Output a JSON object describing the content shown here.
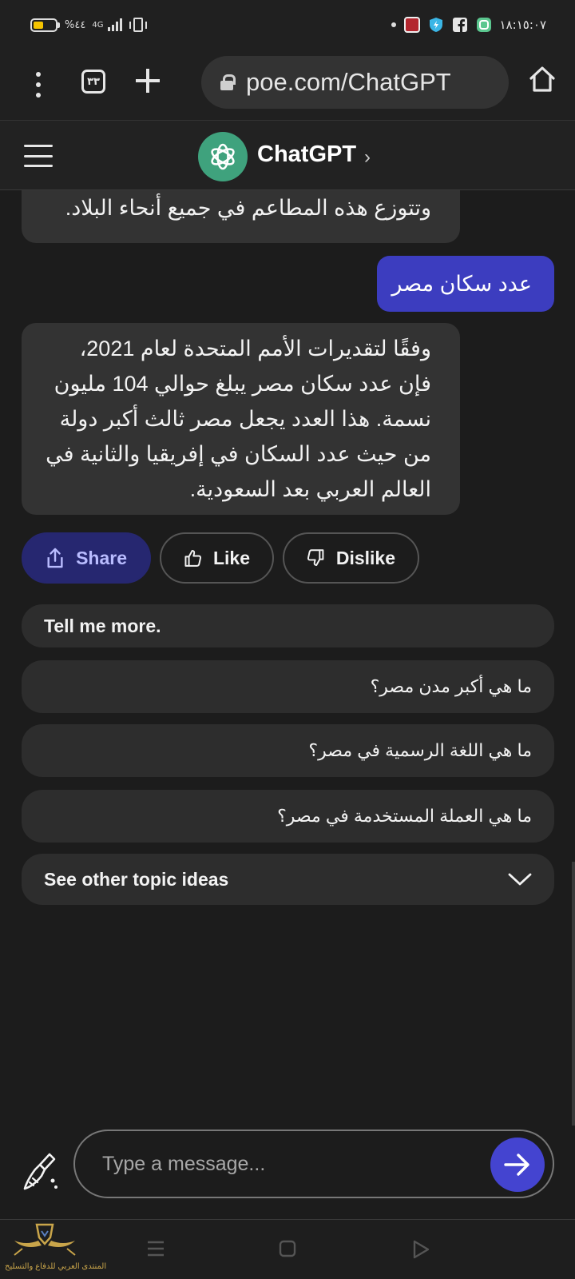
{
  "status_bar": {
    "battery": "%٤٤",
    "network": "4G",
    "time": "١٨:١٥:٠٧",
    "icons": [
      "battery-icon",
      "signal-icon",
      "vibrate-icon",
      "notification-dot-icon",
      "app-notification-icon",
      "shield-app-icon",
      "facebook-icon",
      "chat-app-icon"
    ]
  },
  "browser": {
    "tab_count": "٣٣",
    "url": "poe.com/ChatGPT",
    "icons": [
      "more-vertical-icon",
      "tabs-icon",
      "plus-icon",
      "lock-icon",
      "home-icon"
    ]
  },
  "header": {
    "bot_name": "ChatGPT",
    "chevron": "›",
    "icons": [
      "hamburger-menu-icon",
      "openai-logo-icon"
    ]
  },
  "messages": {
    "previous_bot_tail": "وتتوزع هذه المطاعم في جميع أنحاء البلاد.",
    "user": "عدد سكان مصر",
    "bot_answer": "وفقًا لتقديرات الأمم المتحدة لعام 2021، فإن عدد سكان مصر يبلغ حوالي 104 مليون نسمة. هذا العدد يجعل مصر ثالث أكبر دولة من حيث عدد السكان في إفريقيا والثانية في العالم العربي بعد السعودية."
  },
  "actions": {
    "share": "Share",
    "like": "Like",
    "dislike": "Dislike",
    "colors": {
      "share_bg": "#262770",
      "share_text": "#b9bcff"
    }
  },
  "suggestions": {
    "tell_more": "Tell me more.",
    "q1": "ما هي أكبر مدن مصر؟",
    "q2": "ما هي اللغة الرسمية في مصر؟",
    "q3": "ما هي العملة المستخدمة في مصر؟",
    "other_topics": "See other topic ideas"
  },
  "composer": {
    "placeholder": "Type a message...",
    "icons": [
      "broom-icon",
      "send-arrow-icon"
    ],
    "send_color": "#4444d0"
  },
  "navbar": {
    "icons": [
      "recents-icon",
      "home-square-icon",
      "back-triangle-icon"
    ]
  },
  "watermark": {
    "text": "المنتدى العربي للدفاع والتسليح"
  },
  "colors": {
    "background": "#1c1c1c",
    "bubble_bot": "#333333",
    "bubble_user": "#3c3dbf",
    "bot_avatar": "#3fa27d"
  }
}
